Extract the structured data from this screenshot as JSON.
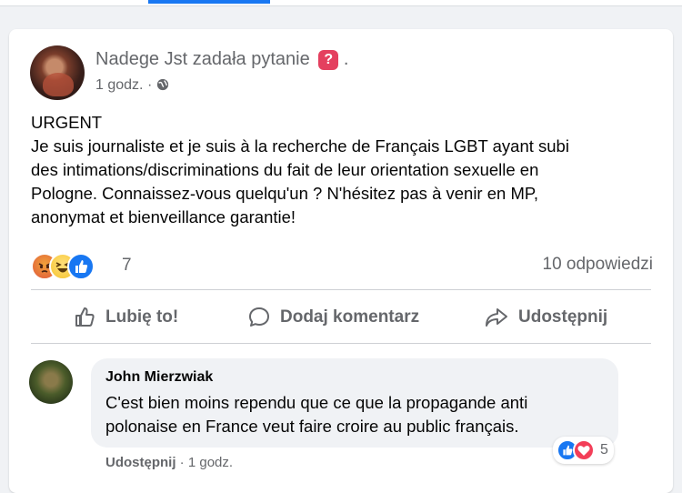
{
  "post": {
    "author_name": "Nadege Jst",
    "author_action": "zadała pytanie",
    "question_badge": "?",
    "trailing_dot": ".",
    "time": "1 godz.",
    "separator": "·",
    "text_lines": [
      "URGENT",
      "Je suis journaliste et je suis à la recherche de Français LGBT ayant subi",
      "des intimations/discriminations du fait de leur orientation sexuelle en",
      "Pologne. Connaissez-vous quelqu'un ? N'hésitez pas à venir en MP,",
      "anonymat et bienveillance garantie!"
    ],
    "reaction_icons": [
      "angry-icon",
      "haha-icon",
      "like-icon"
    ],
    "reaction_count": "7",
    "answers_count": "10 odpowiedzi"
  },
  "actions": {
    "like_label": "Lubię to!",
    "comment_label": "Dodaj komentarz",
    "share_label": "Udostępnij"
  },
  "comment": {
    "author": "John Mierzwiak",
    "text_lines": [
      "C'est bien moins rependu que ce que la propagande anti",
      "polonaise en France veut faire croire au public français."
    ],
    "reaction_icons": [
      "like-icon",
      "love-icon"
    ],
    "reaction_count": "5",
    "share_label": "Udostępnij",
    "separator": "·",
    "time": "1 godz."
  },
  "colors": {
    "accent": "#1877f2",
    "secondary_text": "#65676b",
    "question_badge": "#e4405f"
  }
}
